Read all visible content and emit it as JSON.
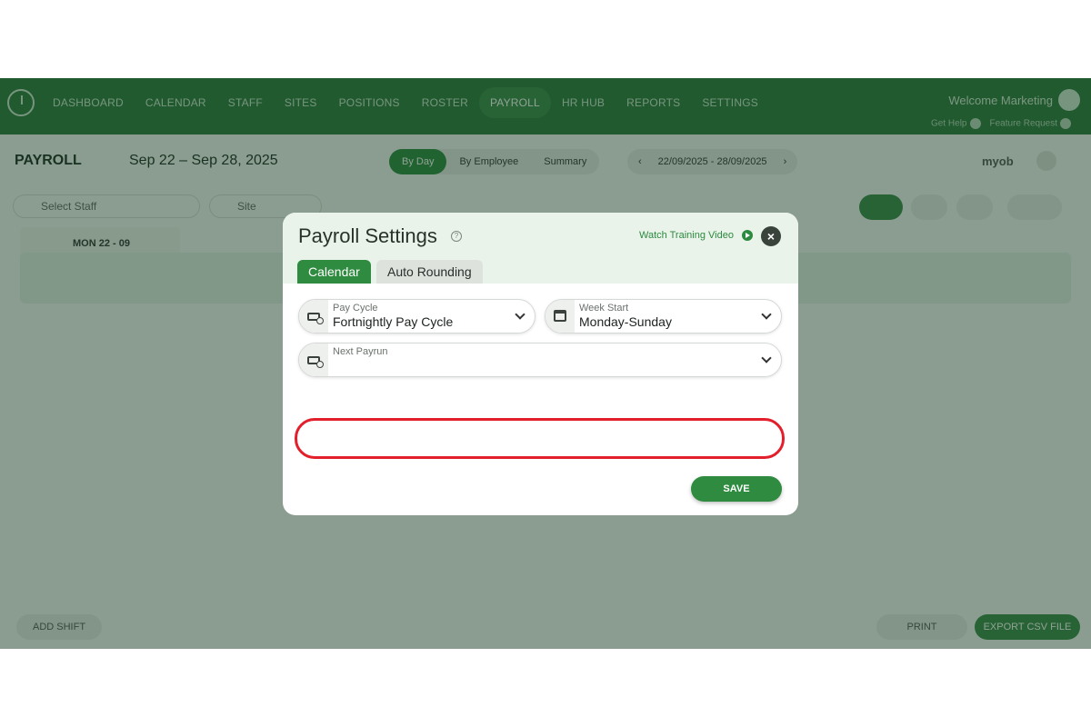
{
  "nav": {
    "items": [
      "DASHBOARD",
      "CALENDAR",
      "STAFF",
      "SITES",
      "POSITIONS",
      "ROSTER",
      "PAYROLL",
      "HR HUB",
      "REPORTS",
      "SETTINGS"
    ],
    "active": "PAYROLL",
    "welcome": "Welcome Marketing",
    "get_help": "Get Help",
    "feature_request": "Feature Request"
  },
  "page": {
    "title": "PAYROLL",
    "date_range": "Sep 22 – Sep 28, 2025",
    "view_tabs": [
      "By Day",
      "By Employee",
      "Summary"
    ],
    "range_text": "22/09/2025 - 28/09/2025",
    "brand": "myob",
    "select_staff_placeholder": "Select Staff",
    "site_placeholder": "Site",
    "day_label": "MON 22 - 09",
    "add_shift": "ADD SHIFT",
    "print": "PRINT",
    "export_csv": "EXPORT CSV FILE"
  },
  "modal": {
    "title": "Payroll Settings",
    "watch_training": "Watch Training Video",
    "tabs": [
      "Calendar",
      "Auto Rounding"
    ],
    "pay_cycle": {
      "label": "Pay Cycle",
      "value": "Fortnightly Pay Cycle"
    },
    "week_start": {
      "label": "Week Start",
      "value": "Monday-Sunday"
    },
    "next_payrun": {
      "label": "Next Payrun",
      "value": ""
    },
    "save_label": "SAVE"
  },
  "colors": {
    "brand_green": "#2e8b3f",
    "highlight_red": "#e21f2a"
  }
}
